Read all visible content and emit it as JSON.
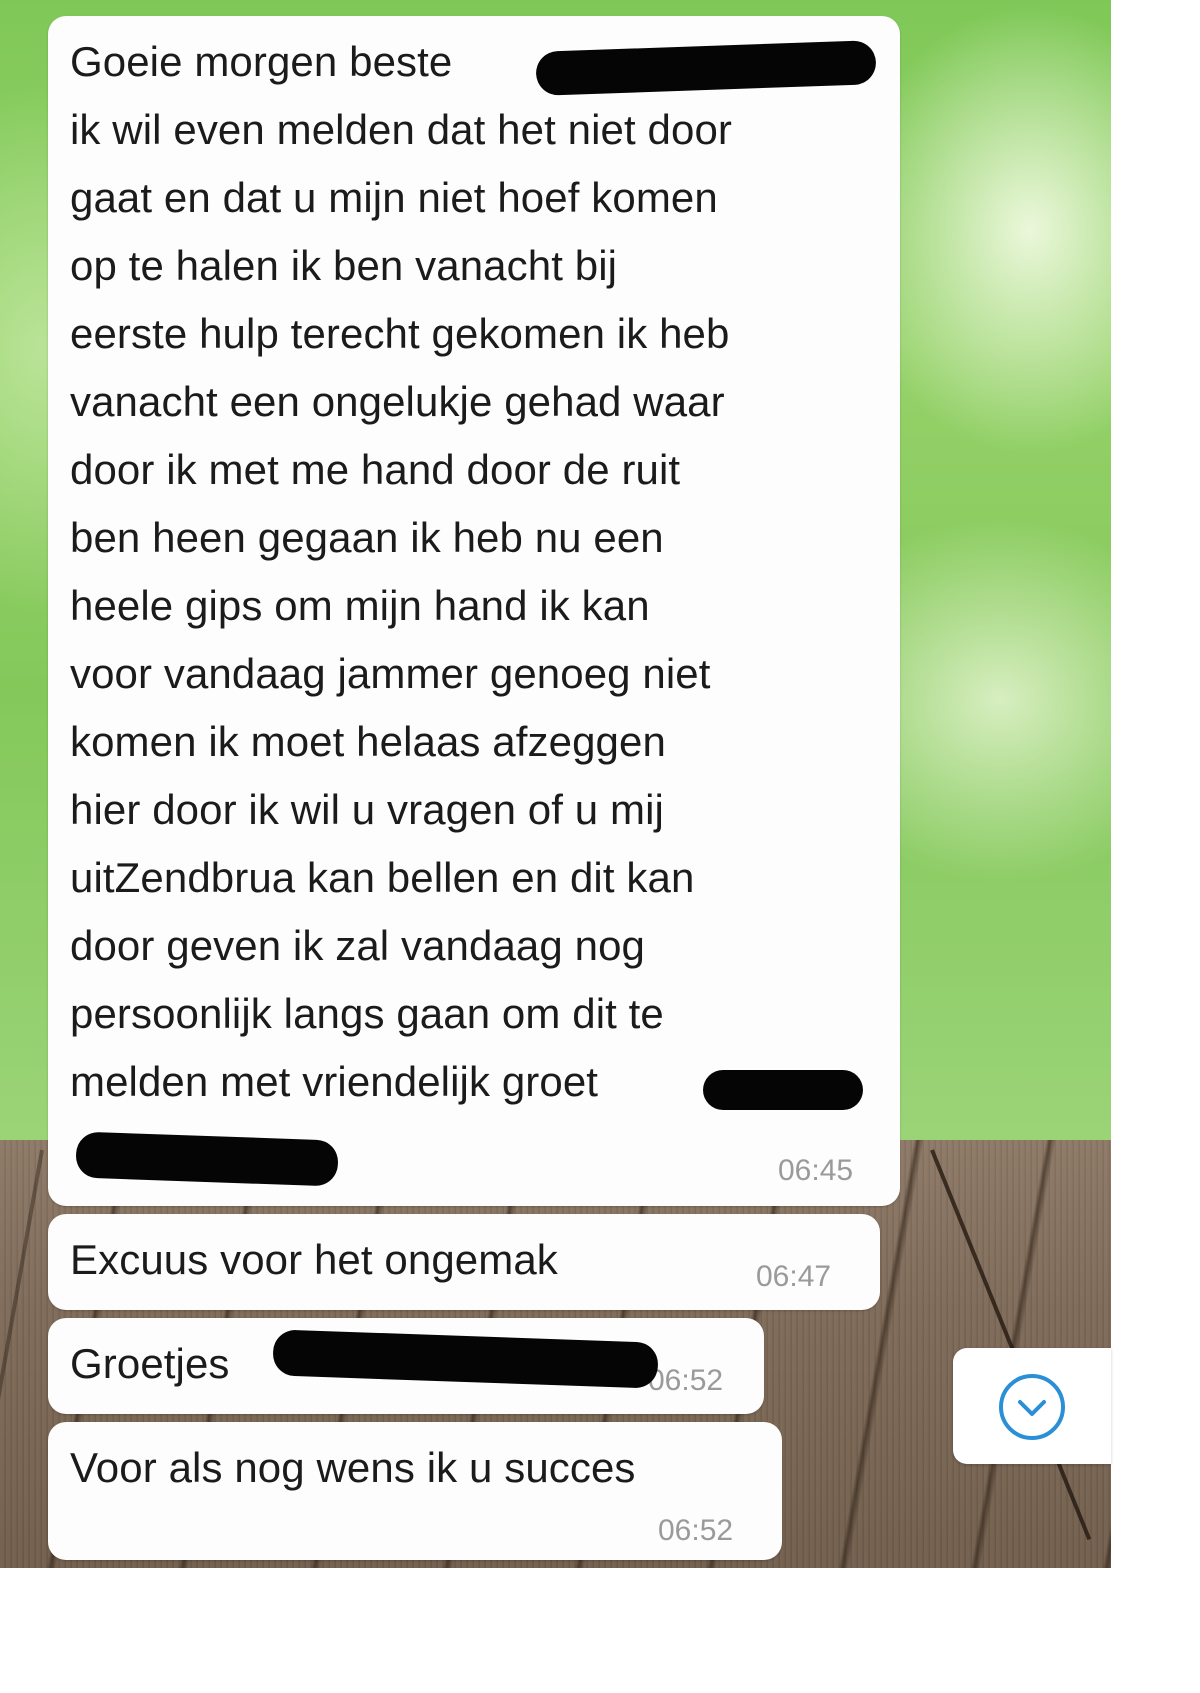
{
  "messages": [
    {
      "text": "Goeie morgen beste \nik wil even melden dat het niet door\ngaat en dat u mijn niet hoef komen\nop te halen ik ben vanacht bij\neerste hulp terecht gekomen ik heb\nvanacht een ongelukje gehad waar\ndoor ik met me hand door de ruit\nben heen gegaan ik heb nu een\nheele  gips om mijn hand ik kan\nvoor vandaag jammer genoeg niet\nkomen ik moet helaas afzeggen\nhier door ik wil u vragen of u mij\nuitZendbrua kan bellen en dit kan\ndoor geven ik zal vandaag nog\npersoonlijk langs gaan om dit te\nmelden met vriendelijk groet",
      "time": "06:45"
    },
    {
      "text": "Excuus voor het ongemak",
      "time": "06:47"
    },
    {
      "text": "Groetjes",
      "time": "06:52"
    },
    {
      "text": "Voor als nog wens ik u succes",
      "time": "06:52"
    }
  ],
  "scroll_button": {
    "icon": "chevron-down-circle-icon",
    "color": "#2b8fd6"
  },
  "colors": {
    "bubble": "#fdfdfd",
    "timestamp": "#9a9a9a",
    "redaction": "#050505"
  }
}
